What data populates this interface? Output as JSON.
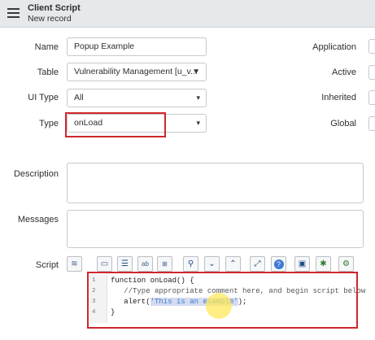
{
  "header": {
    "title": "Client Script",
    "subtitle": "New record"
  },
  "form": {
    "name": {
      "label": "Name",
      "value": "Popup Example"
    },
    "table": {
      "label": "Table",
      "value": "Vulnerability Management [u_v..."
    },
    "ui_type": {
      "label": "UI Type",
      "value": "All"
    },
    "type": {
      "label": "Type",
      "value": "onLoad"
    },
    "application": {
      "label": "Application"
    },
    "active": {
      "label": "Active"
    },
    "inherited": {
      "label": "Inherited"
    },
    "global": {
      "label": "Global"
    },
    "description": {
      "label": "Description",
      "value": ""
    },
    "messages": {
      "label": "Messages",
      "value": ""
    },
    "script": {
      "label": "Script"
    }
  },
  "toolbar": {
    "buttons": [
      "toggle-syntax-icon",
      "comment-icon",
      "format-icon",
      "replace-icon",
      "replace-all-icon",
      "search-icon",
      "chevron-down-icon",
      "chevron-up-icon",
      "fullscreen-icon",
      "help-icon",
      "save-icon",
      "debug-icon",
      "settings-icon"
    ]
  },
  "editor": {
    "line_numbers": [
      "1",
      "2",
      "3",
      "4"
    ],
    "lines": [
      "function onLoad() {",
      "   //Type appropriate comment here, and begin script below",
      "   alert(",
      "'This is an example'",
      ");",
      "}"
    ]
  },
  "colors": {
    "highlight_border": "#d0262b",
    "header_bg": "#e6e9eb",
    "string_color": "#3e7fc2"
  }
}
